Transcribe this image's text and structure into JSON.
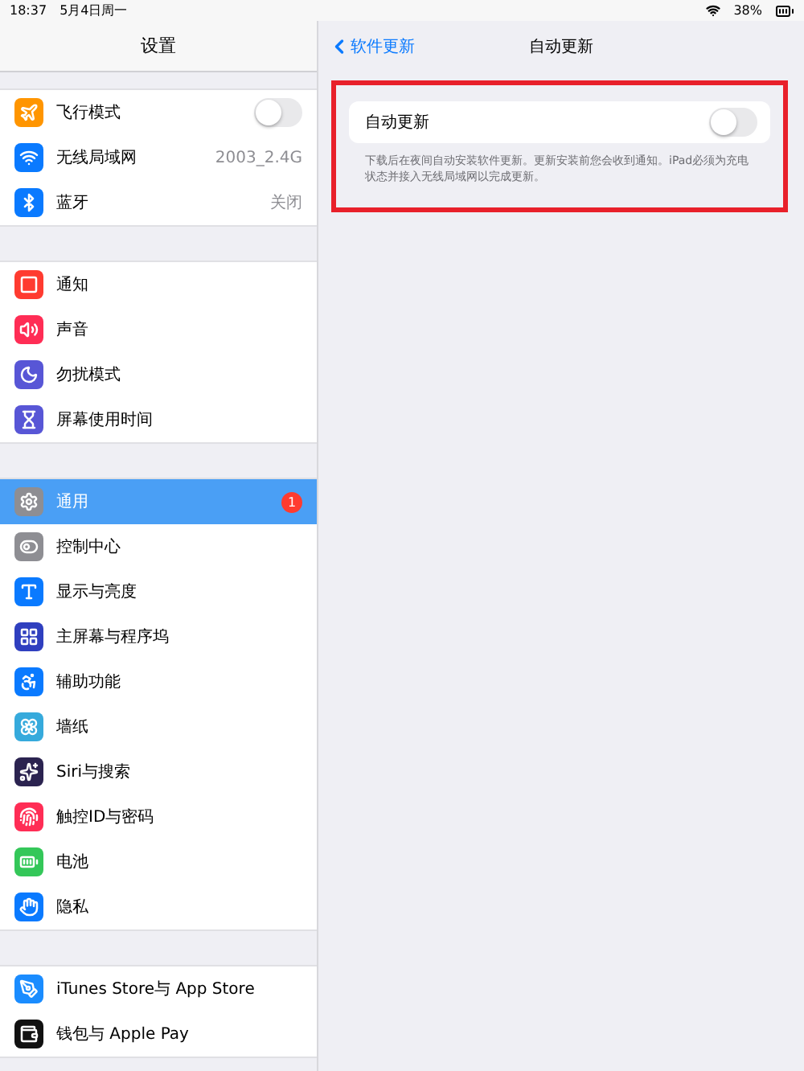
{
  "status_bar": {
    "time": "18:37",
    "date": "5月4日周一",
    "battery": "38%"
  },
  "sidebar": {
    "title": "设置",
    "groups": [
      {
        "items": [
          {
            "label": "飞行模式",
            "color": "#ff9500",
            "kind": "toggle",
            "on": false,
            "selected": false
          },
          {
            "label": "无线局域网",
            "color": "#0a7aff",
            "kind": "value",
            "value": "2003_2.4G",
            "selected": false
          },
          {
            "label": "蓝牙",
            "color": "#0a7aff",
            "kind": "value",
            "value": "关闭",
            "selected": false
          }
        ]
      },
      {
        "items": [
          {
            "label": "通知",
            "color": "#ff3b30",
            "kind": "plain",
            "selected": false
          },
          {
            "label": "声音",
            "color": "#ff2d55",
            "kind": "plain",
            "selected": false
          },
          {
            "label": "勿扰模式",
            "color": "#5856d6",
            "kind": "plain",
            "selected": false
          },
          {
            "label": "屏幕使用时间",
            "color": "#5856d6",
            "kind": "plain",
            "selected": false
          }
        ]
      },
      {
        "items": [
          {
            "label": "通用",
            "color": "#8e8e93",
            "kind": "badge",
            "badge": "1",
            "selected": true
          },
          {
            "label": "控制中心",
            "color": "#8e8e93",
            "kind": "plain",
            "selected": false
          },
          {
            "label": "显示与亮度",
            "color": "#0a7aff",
            "kind": "plain",
            "selected": false
          },
          {
            "label": "主屏幕与程序坞",
            "color": "#2f3fbf",
            "kind": "plain",
            "selected": false
          },
          {
            "label": "辅助功能",
            "color": "#0a7aff",
            "kind": "plain",
            "selected": false
          },
          {
            "label": "墙纸",
            "color": "#36aadc",
            "kind": "plain",
            "selected": false
          },
          {
            "label": "Siri与搜索",
            "color": "#2b2350",
            "kind": "plain",
            "selected": false
          },
          {
            "label": "触控ID与密码",
            "color": "#ff2d55",
            "kind": "plain",
            "selected": false
          },
          {
            "label": "电池",
            "color": "#34c759",
            "kind": "plain",
            "selected": false
          },
          {
            "label": "隐私",
            "color": "#0a7aff",
            "kind": "plain",
            "selected": false
          }
        ]
      },
      {
        "items": [
          {
            "label": "iTunes Store与 App Store",
            "color": "#1a8cff",
            "kind": "plain",
            "selected": false
          },
          {
            "label": "钱包与 Apple Pay",
            "color": "#111111",
            "kind": "plain",
            "selected": false
          }
        ]
      }
    ]
  },
  "detail": {
    "back": "软件更新",
    "title": "自动更新",
    "setting": {
      "label": "自动更新",
      "on": false
    },
    "footer": "下载后在夜间自动安装软件更新。更新安装前您会收到通知。iPad必须为充电状态并接入无线局域网以完成更新。"
  }
}
